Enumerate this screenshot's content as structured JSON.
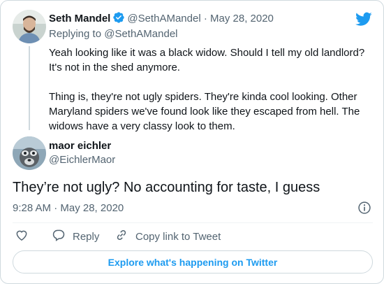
{
  "parent_tweet": {
    "display_name": "Seth Mandel",
    "handle": "@SethAMandel",
    "separator": "·",
    "date": "May 28, 2020",
    "replying_to": "Replying to @SethAMandel",
    "text": "Yeah looking like it was a black widow. Should I tell my old landlord?\nIt's not in the shed anymore.\n\nThing is, they're not ugly spiders. They're kinda cool looking. Other\nMaryland spiders we've found look like they escaped from hell. The\nwidows have a very classy look to them."
  },
  "main_tweet": {
    "display_name": "maor eichler",
    "handle": "@EichlerMaor",
    "text": "They’re not ugly? No accounting for taste, I guess",
    "timestamp": "9:28 AM · May 28, 2020"
  },
  "actions": {
    "like_icon": "heart-icon",
    "reply_label": "Reply",
    "copy_label": "Copy link to Tweet"
  },
  "explore_label": "Explore what's happening on Twitter",
  "colors": {
    "brand": "#1d9bf0",
    "text": "#0f1419",
    "muted": "#536471",
    "border": "#cfd9de"
  }
}
